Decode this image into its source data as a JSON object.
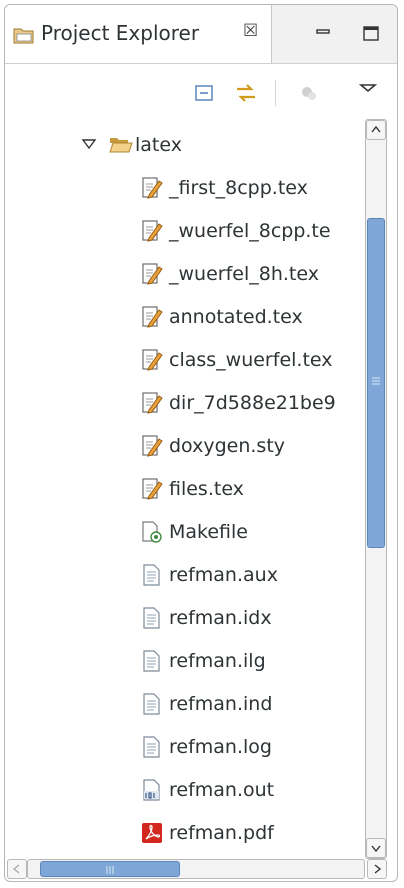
{
  "view": {
    "title": "Project Explorer",
    "close_glyph": "☒"
  },
  "icons": {
    "tab": "folder-view-icon",
    "minimize": "minimize-icon",
    "maximize": "maximize-icon",
    "collapse_all": "collapse-all-icon",
    "link_editor": "link-with-editor-icon",
    "focus": "focus-on-active-task-icon",
    "view_menu": "view-menu-icon"
  },
  "tree": {
    "folder": "latex",
    "files": [
      {
        "label": "_first_8cpp.tex",
        "icon": "tex-file-icon"
      },
      {
        "label": "_wuerfel_8cpp.te",
        "icon": "tex-file-icon"
      },
      {
        "label": "_wuerfel_8h.tex",
        "icon": "tex-file-icon"
      },
      {
        "label": "annotated.tex",
        "icon": "tex-file-icon"
      },
      {
        "label": "class_wuerfel.tex",
        "icon": "tex-file-icon"
      },
      {
        "label": "dir_7d588e21be9",
        "icon": "tex-file-icon"
      },
      {
        "label": "doxygen.sty",
        "icon": "tex-file-icon"
      },
      {
        "label": "files.tex",
        "icon": "tex-file-icon"
      },
      {
        "label": "Makefile",
        "icon": "makefile-icon"
      },
      {
        "label": "refman.aux",
        "icon": "text-file-icon"
      },
      {
        "label": "refman.idx",
        "icon": "text-file-icon"
      },
      {
        "label": "refman.ilg",
        "icon": "text-file-icon"
      },
      {
        "label": "refman.ind",
        "icon": "text-file-icon"
      },
      {
        "label": "refman.log",
        "icon": "text-file-icon"
      },
      {
        "label": "refman.out",
        "icon": "binary-file-icon"
      },
      {
        "label": "refman.pdf",
        "icon": "pdf-file-icon"
      }
    ]
  },
  "scroll": {
    "vertical_fraction": 0.45,
    "horizontal_fraction": 0.3
  }
}
